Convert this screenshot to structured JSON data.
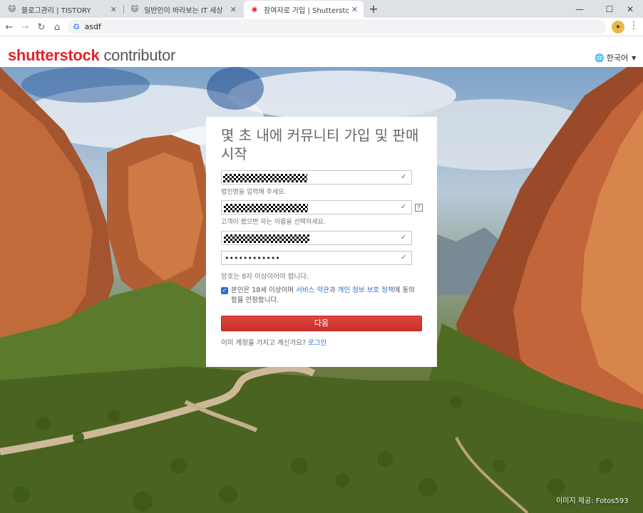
{
  "browser": {
    "tabs": [
      {
        "title": "블로그관리 | TISTORY",
        "active": false
      },
      {
        "title": "일반인이 바라보는 IT 세상",
        "active": false
      },
      {
        "title": "참여자로 가입 | Shutterstock",
        "active": true
      }
    ],
    "address": "asdf"
  },
  "site": {
    "brand": "shutterstock",
    "brand_sub": "contributor",
    "language": "한국어"
  },
  "form": {
    "heading": "몇 초 내에 커뮤니티 가입 및 판매 시작",
    "hint_name": "법인명을 입력해 주세요.",
    "hint_display": "고객이 봤으면 하는 이름을 선택하세요.",
    "password_mask": "••••••••••••",
    "help_mark": "?",
    "password_note": "암호는 8자 이상이어야 합니다.",
    "agree_pre": "본인은 18세 이상이며 ",
    "agree_terms": "서비스 약관",
    "agree_and": "과 ",
    "agree_privacy": "개인 정보 보호 정책",
    "agree_post": "에 동의함을 인정합니다.",
    "next_label": "다음",
    "login_prompt": "이미 계정을 가지고 계신가요? ",
    "login_link": "로그인"
  },
  "hero": {
    "credit": "이미지 제공: Fotos593"
  },
  "colors": {
    "brand_red": "#e2242b",
    "button_red": "#d63a33",
    "link_blue": "#2a6ecf",
    "check_green": "#2e9c3a"
  }
}
